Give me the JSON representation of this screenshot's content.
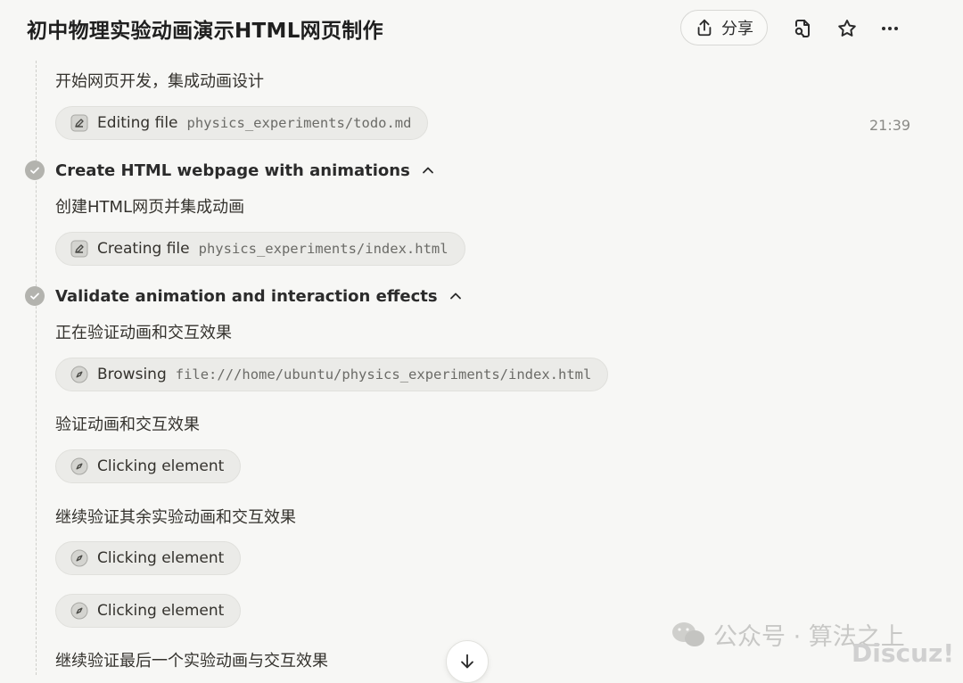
{
  "header": {
    "title": "初中物理实验动画演示HTML网页制作",
    "share_label": "分享",
    "icons": [
      "share-upload-icon",
      "file-search-icon",
      "star-icon",
      "more-icon"
    ]
  },
  "timeline": {
    "note_top": "开始网页开发，集成动画设计",
    "action1": {
      "verb": "Editing file",
      "path": "physics_experiments/todo.md",
      "icon": "edit-icon"
    },
    "timestamp": "21:39",
    "step2": {
      "title": "Create HTML webpage with animations",
      "note": "创建HTML网页并集成动画",
      "action": {
        "verb": "Creating file",
        "path": "physics_experiments/index.html",
        "icon": "edit-icon"
      }
    },
    "step3": {
      "title": "Validate animation and interaction effects",
      "note1": "正在验证动画和交互效果",
      "action1": {
        "verb": "Browsing",
        "path": "file:///home/ubuntu/physics_experiments/index.html",
        "icon": "compass-icon"
      },
      "note2": "验证动画和交互效果",
      "action2": {
        "verb": "Clicking element",
        "icon": "compass-icon"
      },
      "note3": "继续验证其余实验动画和交互效果",
      "action3": {
        "verb": "Clicking element",
        "icon": "compass-icon"
      },
      "action4": {
        "verb": "Clicking element",
        "icon": "compass-icon"
      },
      "note4": "继续验证最后一个实验动画与交互效果"
    }
  },
  "watermark": {
    "text": "公众号 · 算法之上",
    "logo": "Discuz!"
  },
  "colors": {
    "background": "#f7f7f5",
    "pill_bg": "#ebebe8",
    "check_bg": "#b3b3ae"
  }
}
